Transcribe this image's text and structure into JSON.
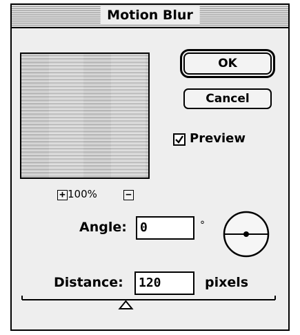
{
  "dialog": {
    "title": "Motion Blur"
  },
  "buttons": {
    "ok": "OK",
    "cancel": "Cancel"
  },
  "preview_checkbox": {
    "label": "Preview",
    "checked": true
  },
  "zoom": {
    "level": "100%",
    "zoom_in_symbol": "+",
    "zoom_out_symbol": "−"
  },
  "angle": {
    "label": "Angle:",
    "value": "0",
    "unit": "°"
  },
  "distance": {
    "label": "Distance:",
    "value": "120",
    "unit": "pixels",
    "slider_fraction": 0.41
  },
  "icons": {
    "zoom_in": "plus-icon",
    "zoom_out": "minus-icon",
    "angle_dial": "angle-dial-icon",
    "slider_thumb": "triangle-thumb-icon"
  }
}
